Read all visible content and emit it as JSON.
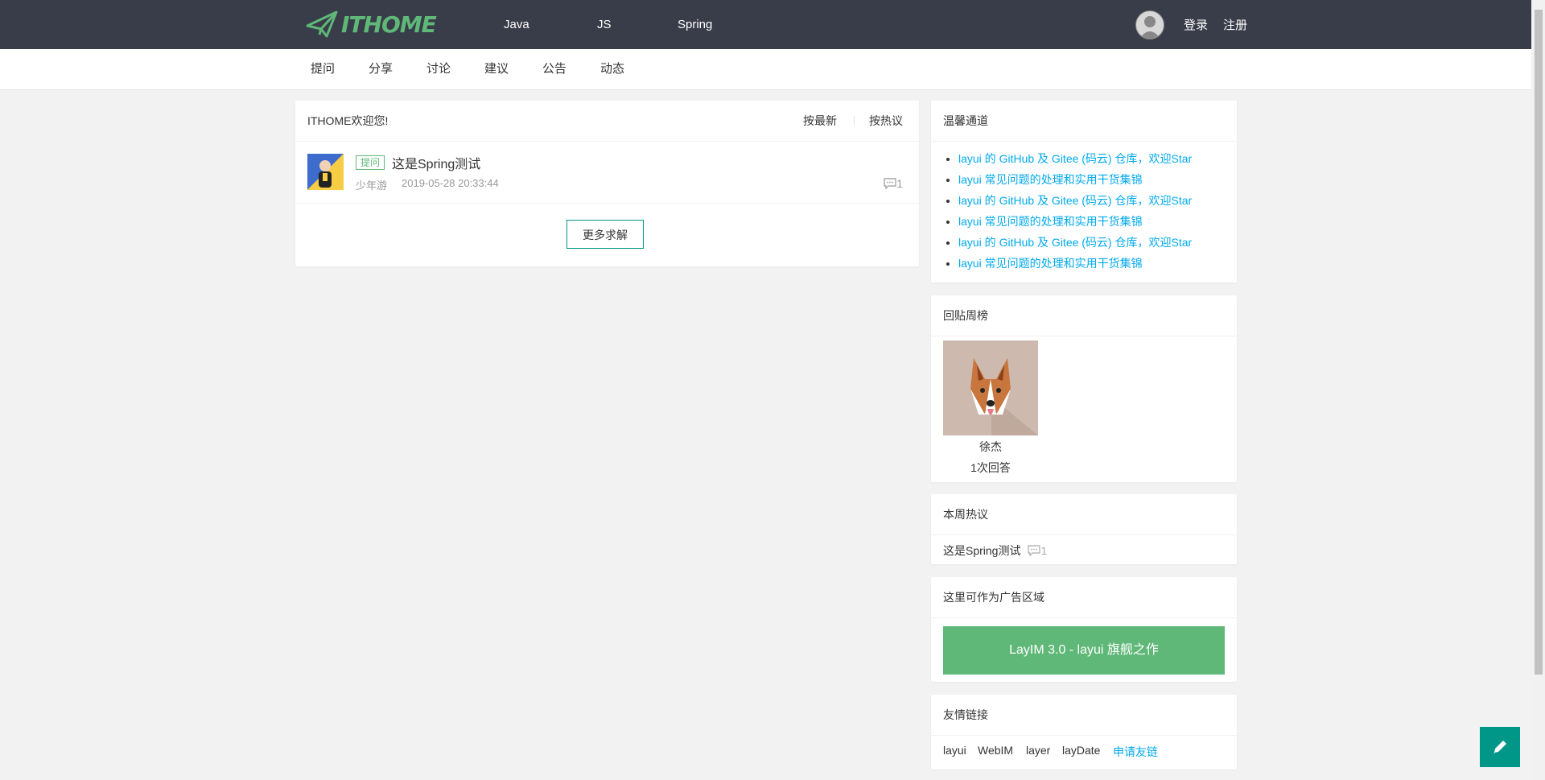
{
  "header": {
    "logo_text": "ITHOME",
    "nav": [
      "Java",
      "JS",
      "Spring"
    ],
    "login": "登录",
    "register": "注册"
  },
  "subnav": [
    "提问",
    "分享",
    "讨论",
    "建议",
    "公告",
    "动态"
  ],
  "main": {
    "welcome": "ITHOME欢迎您!",
    "sort_new": "按最新",
    "sort_hot": "按热议",
    "topic": {
      "badge": "提问",
      "title": "这是Spring测试",
      "author": "少年游",
      "time": "2019-05-28 20:33:44",
      "replies": "1"
    },
    "more_button": "更多求解"
  },
  "warm": {
    "title": "温馨通道",
    "links": [
      "layui 的 GitHub 及 Gitee (码云) 仓库，欢迎Star",
      "layui 常见问题的处理和实用干货集锦",
      "layui 的 GitHub 及 Gitee (码云) 仓库，欢迎Star",
      "layui 常见问题的处理和实用干货集锦",
      "layui 的 GitHub 及 Gitee (码云) 仓库，欢迎Star",
      "layui 常见问题的处理和实用干货集锦"
    ]
  },
  "weekly_rank": {
    "title": "回贴周榜",
    "user_name": "徐杰",
    "answers": "1次回答"
  },
  "hot_week": {
    "title": "本周热议",
    "item_title": "这是Spring测试",
    "item_replies": "1"
  },
  "ad": {
    "title": "这里可作为广告区域",
    "button": "LayIM 3.0 - layui 旗舰之作"
  },
  "friend_links": {
    "title": "友情链接",
    "links": [
      "layui",
      "WebIM",
      "layer",
      "layDate"
    ],
    "apply": "申请友链"
  },
  "colors": {
    "header_bg": "#393d49",
    "accent_green": "#5fb878",
    "teal": "#009688",
    "link_blue": "#01aaed"
  }
}
